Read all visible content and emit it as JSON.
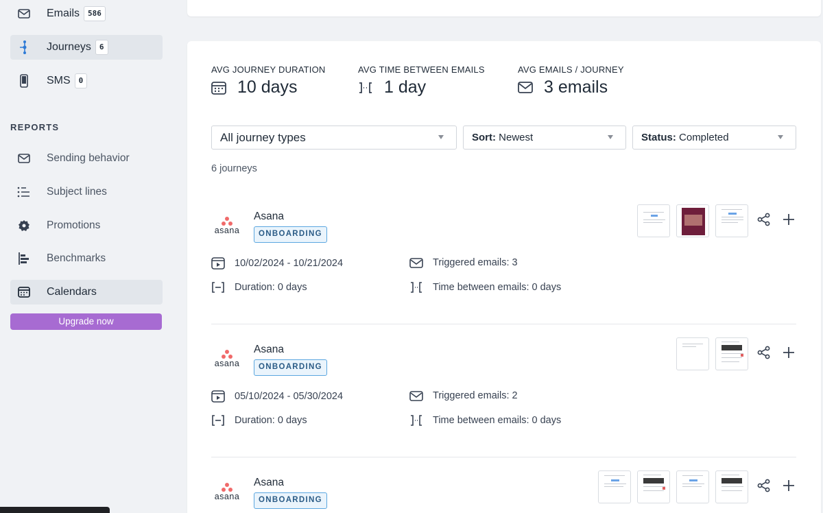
{
  "sidebar": {
    "nav": [
      {
        "label": "Emails",
        "count": "586",
        "icon": "envelope-icon"
      },
      {
        "label": "Journeys",
        "count": "6",
        "icon": "journey-icon"
      },
      {
        "label": "SMS",
        "count": "0",
        "icon": "phone-icon"
      }
    ],
    "reports_heading": "REPORTS",
    "reports": [
      {
        "label": "Sending behavior",
        "icon": "envelope-icon"
      },
      {
        "label": "Subject lines",
        "icon": "list-icon"
      },
      {
        "label": "Promotions",
        "icon": "badge-icon"
      },
      {
        "label": "Benchmarks",
        "icon": "bar-chart-icon"
      },
      {
        "label": "Calendars",
        "icon": "calendar-icon"
      }
    ],
    "upgrade_label": "Upgrade now"
  },
  "stats": [
    {
      "label": "AVG JOURNEY DURATION",
      "value": "10 days",
      "icon": "calendar-icon"
    },
    {
      "label": "AVG TIME BETWEEN EMAILS",
      "value": "1 day",
      "icon": "interval-icon"
    },
    {
      "label": "AVG EMAILS / JOURNEY",
      "value": "3 emails",
      "icon": "envelope-icon"
    }
  ],
  "filters": {
    "type": "All journey types",
    "sort_label": "Sort:",
    "sort_value": "Newest",
    "status_label": "Status:",
    "status_value": "Completed"
  },
  "journey_count": "6 journeys",
  "journeys": [
    {
      "brand": "Asana",
      "logo_text": "asana",
      "type": "ONBOARDING",
      "dates": "10/02/2024 - 10/21/2024",
      "triggered": "Triggered emails: 3",
      "duration": "Duration: 0 days",
      "between": "Time between emails: 0 days"
    },
    {
      "brand": "Asana",
      "logo_text": "asana",
      "type": "ONBOARDING",
      "dates": "05/10/2024 - 05/30/2024",
      "triggered": "Triggered emails: 2",
      "duration": "Duration: 0 days",
      "between": "Time between emails: 0 days"
    },
    {
      "brand": "Asana",
      "logo_text": "asana",
      "type": "ONBOARDING"
    }
  ],
  "colors": {
    "upgrade": "#a76bd2",
    "badge_border": "#5aa6e0",
    "asana_logo": "#f06a6a"
  }
}
